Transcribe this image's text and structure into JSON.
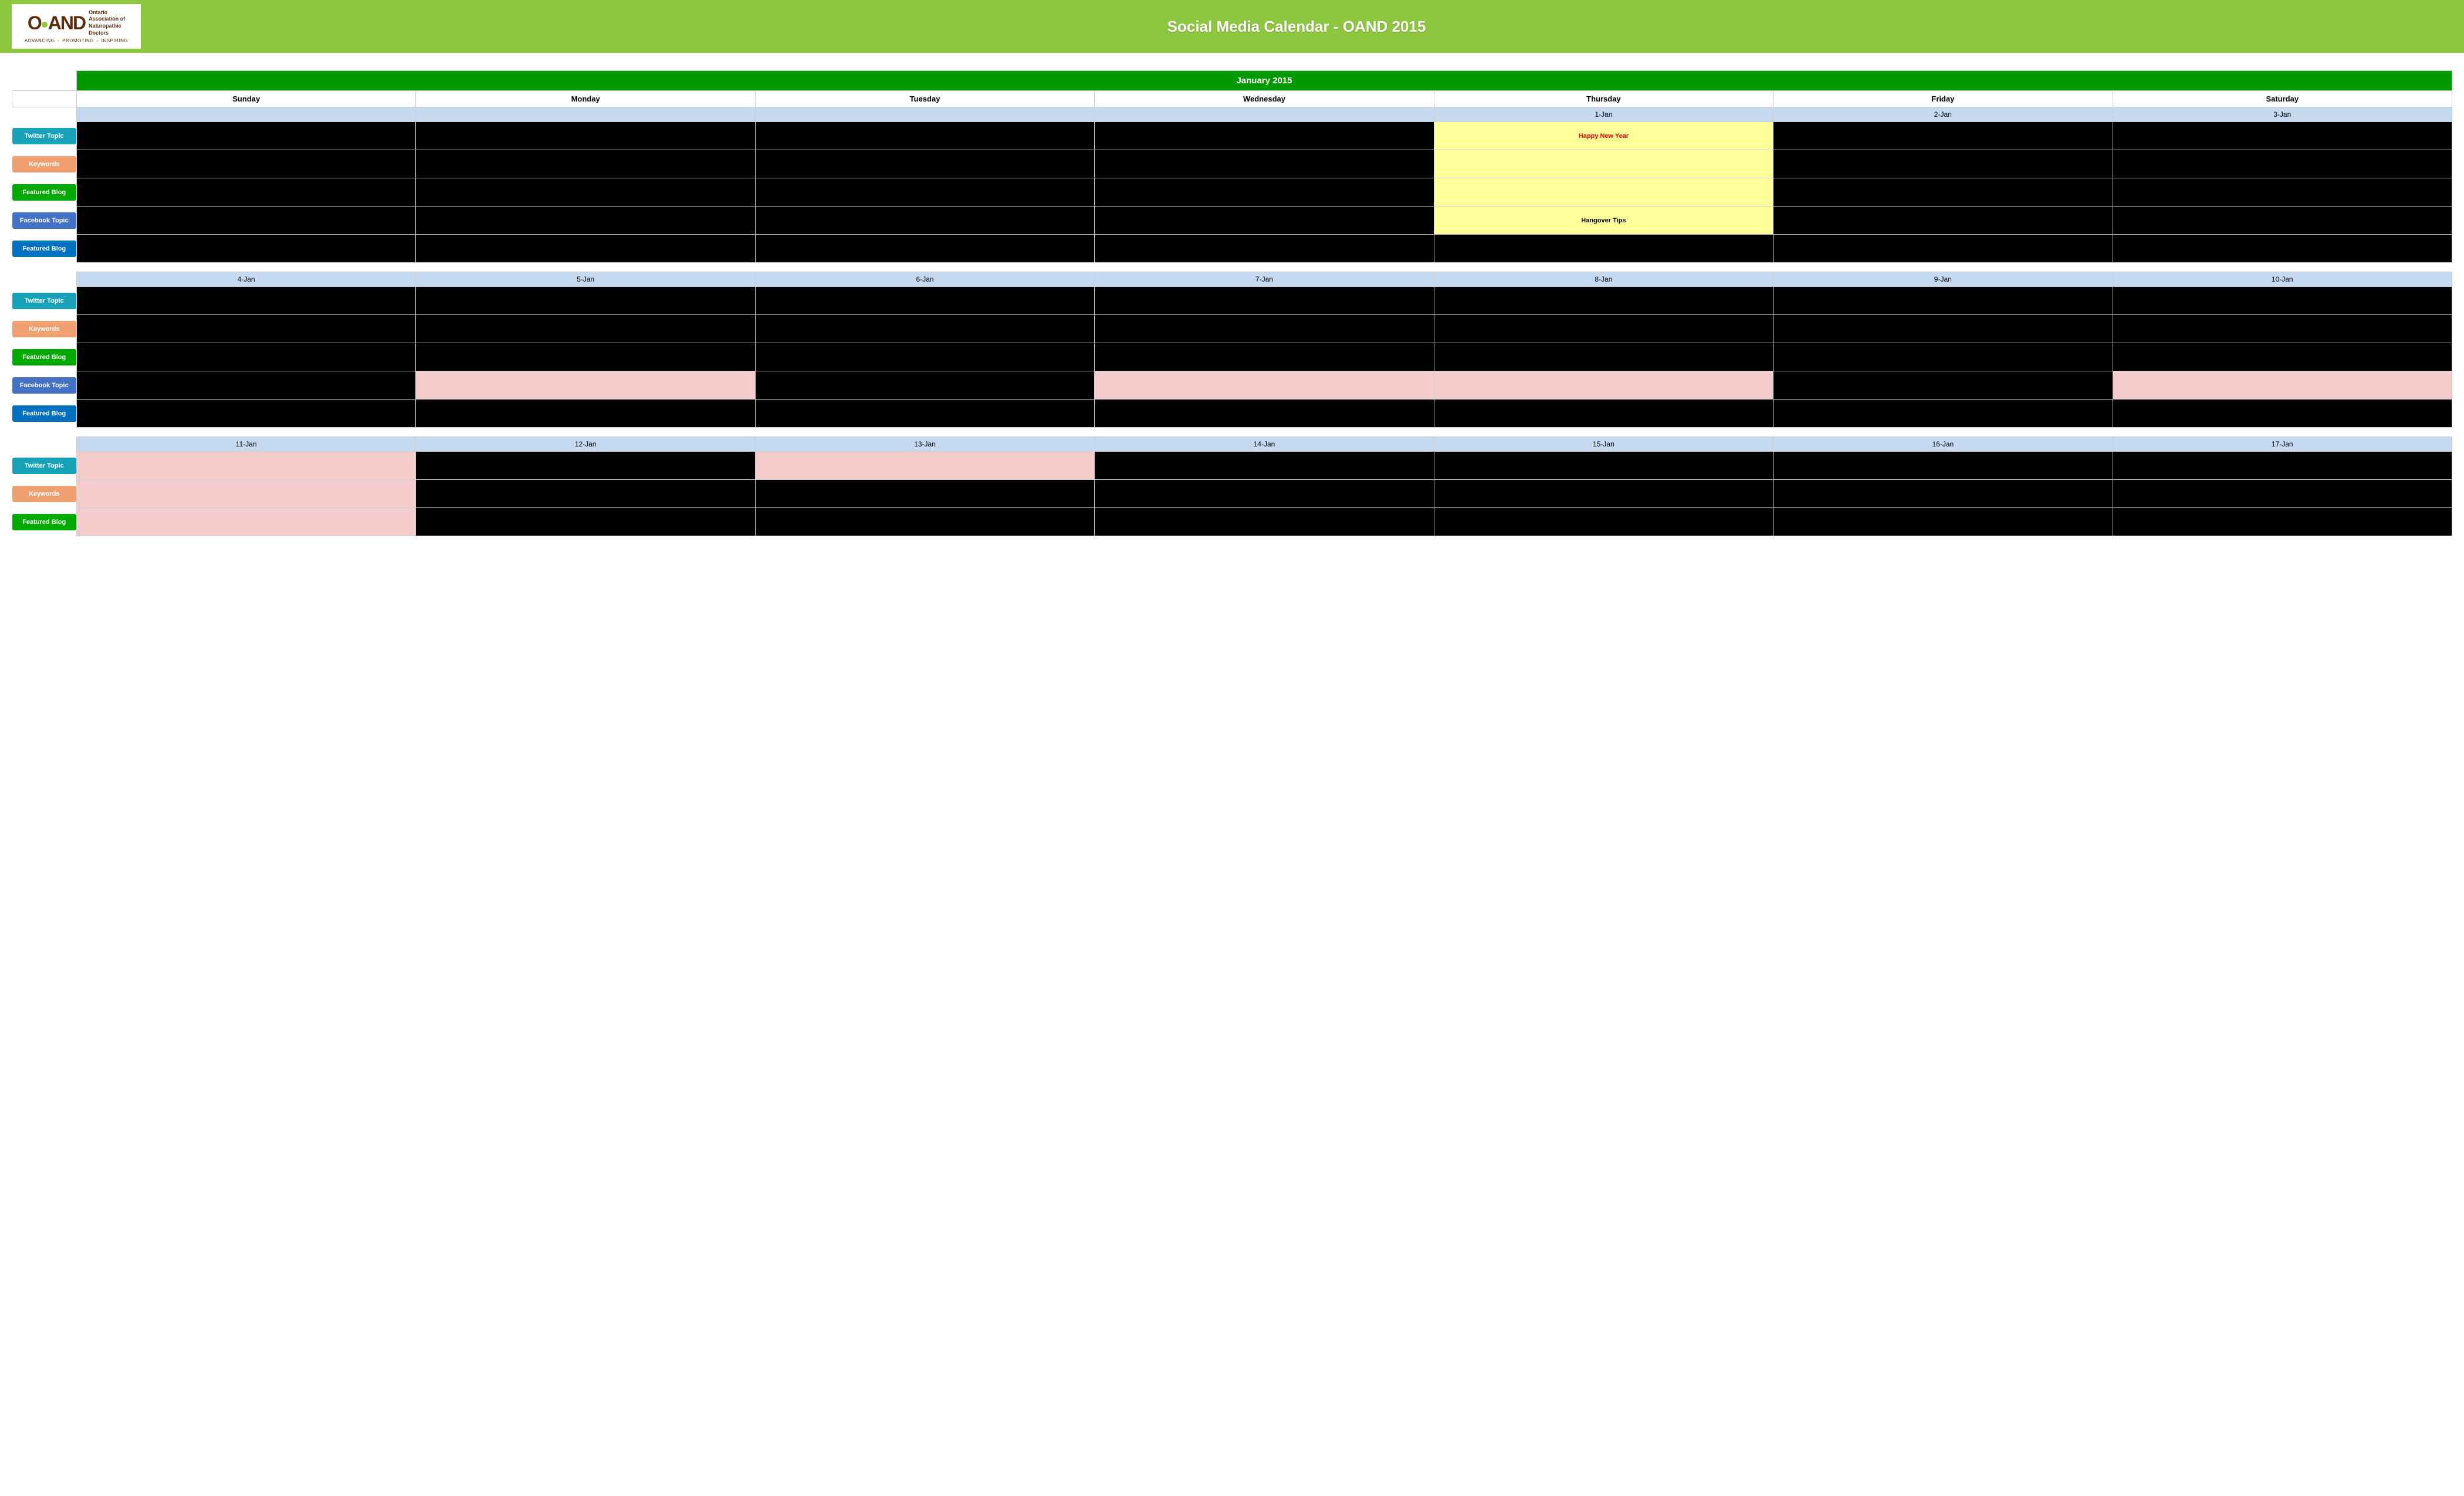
{
  "header": {
    "title": "Social Media Calendar - OAND 2015",
    "logo": {
      "oand": "OAND",
      "org_line1": "Ontario",
      "org_line2": "Association of",
      "org_line3": "Naturopathic",
      "org_line4": "Doctors",
      "tagline_1": "ADVANCING",
      "tagline_dot": "•",
      "tagline_2": "PROMOTING",
      "tagline_3": "INSPIRING"
    }
  },
  "calendar": {
    "month_label": "January 2015",
    "days": [
      "Sunday",
      "Monday",
      "Tuesday",
      "Wednesday",
      "Thursday",
      "Friday",
      "Saturday"
    ],
    "row_labels": {
      "twitter": "Twitter Topic",
      "keywords": "Keywords",
      "featured_blog": "Featured Blog",
      "facebook": "Facebook Topic",
      "featured_blog2": "Featured Blog"
    },
    "weeks": [
      {
        "dates": [
          "",
          "",
          "",
          "",
          "1-Jan",
          "2-Jan",
          "3-Jan"
        ],
        "rows": {
          "twitter": [
            "black",
            "black",
            "black",
            "black",
            "yellow",
            "black",
            "black"
          ],
          "keywords": [
            "black",
            "black",
            "black",
            "black",
            "yellow",
            "black",
            "black"
          ],
          "featured": [
            "black",
            "black",
            "black",
            "black",
            "yellow",
            "black",
            "black"
          ],
          "facebook": [
            "black",
            "black",
            "black",
            "black",
            "yellow",
            "black",
            "black"
          ],
          "featured2": [
            "black",
            "black",
            "black",
            "black",
            "black",
            "black",
            "black"
          ]
        },
        "content": {
          "twitter_thu": {
            "text": "Happy New Year",
            "color": "red"
          },
          "facebook_thu": {
            "text": "Hangover Tips",
            "color": "black"
          }
        }
      },
      {
        "dates": [
          "4-Jan",
          "5-Jan",
          "6-Jan",
          "7-Jan",
          "8-Jan",
          "9-Jan",
          "10-Jan"
        ],
        "rows": {
          "twitter": [
            "black",
            "black",
            "black",
            "black",
            "black",
            "black",
            "black"
          ],
          "keywords": [
            "black",
            "black",
            "black",
            "black",
            "black",
            "black",
            "black"
          ],
          "featured": [
            "black",
            "black",
            "black",
            "black",
            "black",
            "black",
            "black"
          ],
          "facebook": [
            "black",
            "pink",
            "black",
            "pink",
            "pink",
            "black",
            "pink"
          ],
          "featured2": [
            "black",
            "black",
            "black",
            "black",
            "black",
            "black",
            "black"
          ]
        }
      },
      {
        "dates": [
          "11-Jan",
          "12-Jan",
          "13-Jan",
          "14-Jan",
          "15-Jan",
          "16-Jan",
          "17-Jan"
        ],
        "rows": {
          "twitter": [
            "pink",
            "black",
            "pink",
            "black",
            "black",
            "black",
            "black"
          ],
          "keywords": [
            "pink",
            "black",
            "black",
            "black",
            "black",
            "black",
            "black"
          ],
          "featured": [
            "pink",
            "black",
            "black",
            "black",
            "black",
            "black",
            "black"
          ],
          "facebook": [],
          "featured2": []
        }
      }
    ]
  }
}
